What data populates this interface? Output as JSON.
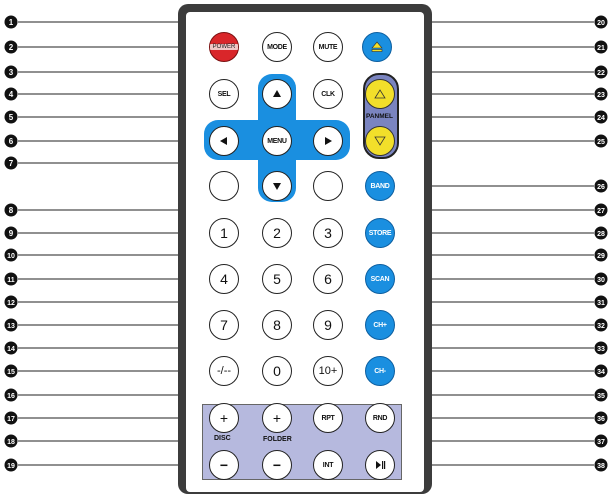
{
  "callouts": {
    "left": [
      "1",
      "2",
      "3",
      "4",
      "5",
      "6",
      "7",
      "8",
      "9",
      "10",
      "11",
      "12",
      "13",
      "14",
      "15",
      "16",
      "17",
      "18",
      "19"
    ],
    "right": [
      "20",
      "21",
      "22",
      "23",
      "24",
      "25",
      "26",
      "27",
      "28",
      "29",
      "30",
      "31",
      "32",
      "33",
      "34",
      "35",
      "36",
      "37",
      "38"
    ]
  },
  "buttons": {
    "mode": "MODE",
    "power": "POWER",
    "mute": "MUTE",
    "sel": "SEL",
    "clk": "CLK",
    "menu": "MENU",
    "band": "BAND",
    "num1": "1",
    "num2": "2",
    "num3": "3",
    "num4": "4",
    "num5": "5",
    "num6": "6",
    "num7": "7",
    "num8": "8",
    "num9": "9",
    "num0": "0",
    "dash": "-/--",
    "ten_plus": "10+",
    "store": "STORE",
    "scan": "SCAN",
    "ch_plus": "CH+",
    "ch_minus": "CH-",
    "rpt": "RPT",
    "rnd": "RND",
    "int": "INT",
    "plus": "+",
    "minus": "−"
  },
  "labels": {
    "panmel": "PANMEL",
    "disc": "DISC",
    "folder": "FOLDER"
  },
  "colors": {
    "remote_body": "#3c3c3c",
    "accent_blue": "#1a8fe0",
    "power_red": "#d9262a",
    "panel_yellow": "#f2df2a",
    "disc_panel": "#b6b9de"
  }
}
